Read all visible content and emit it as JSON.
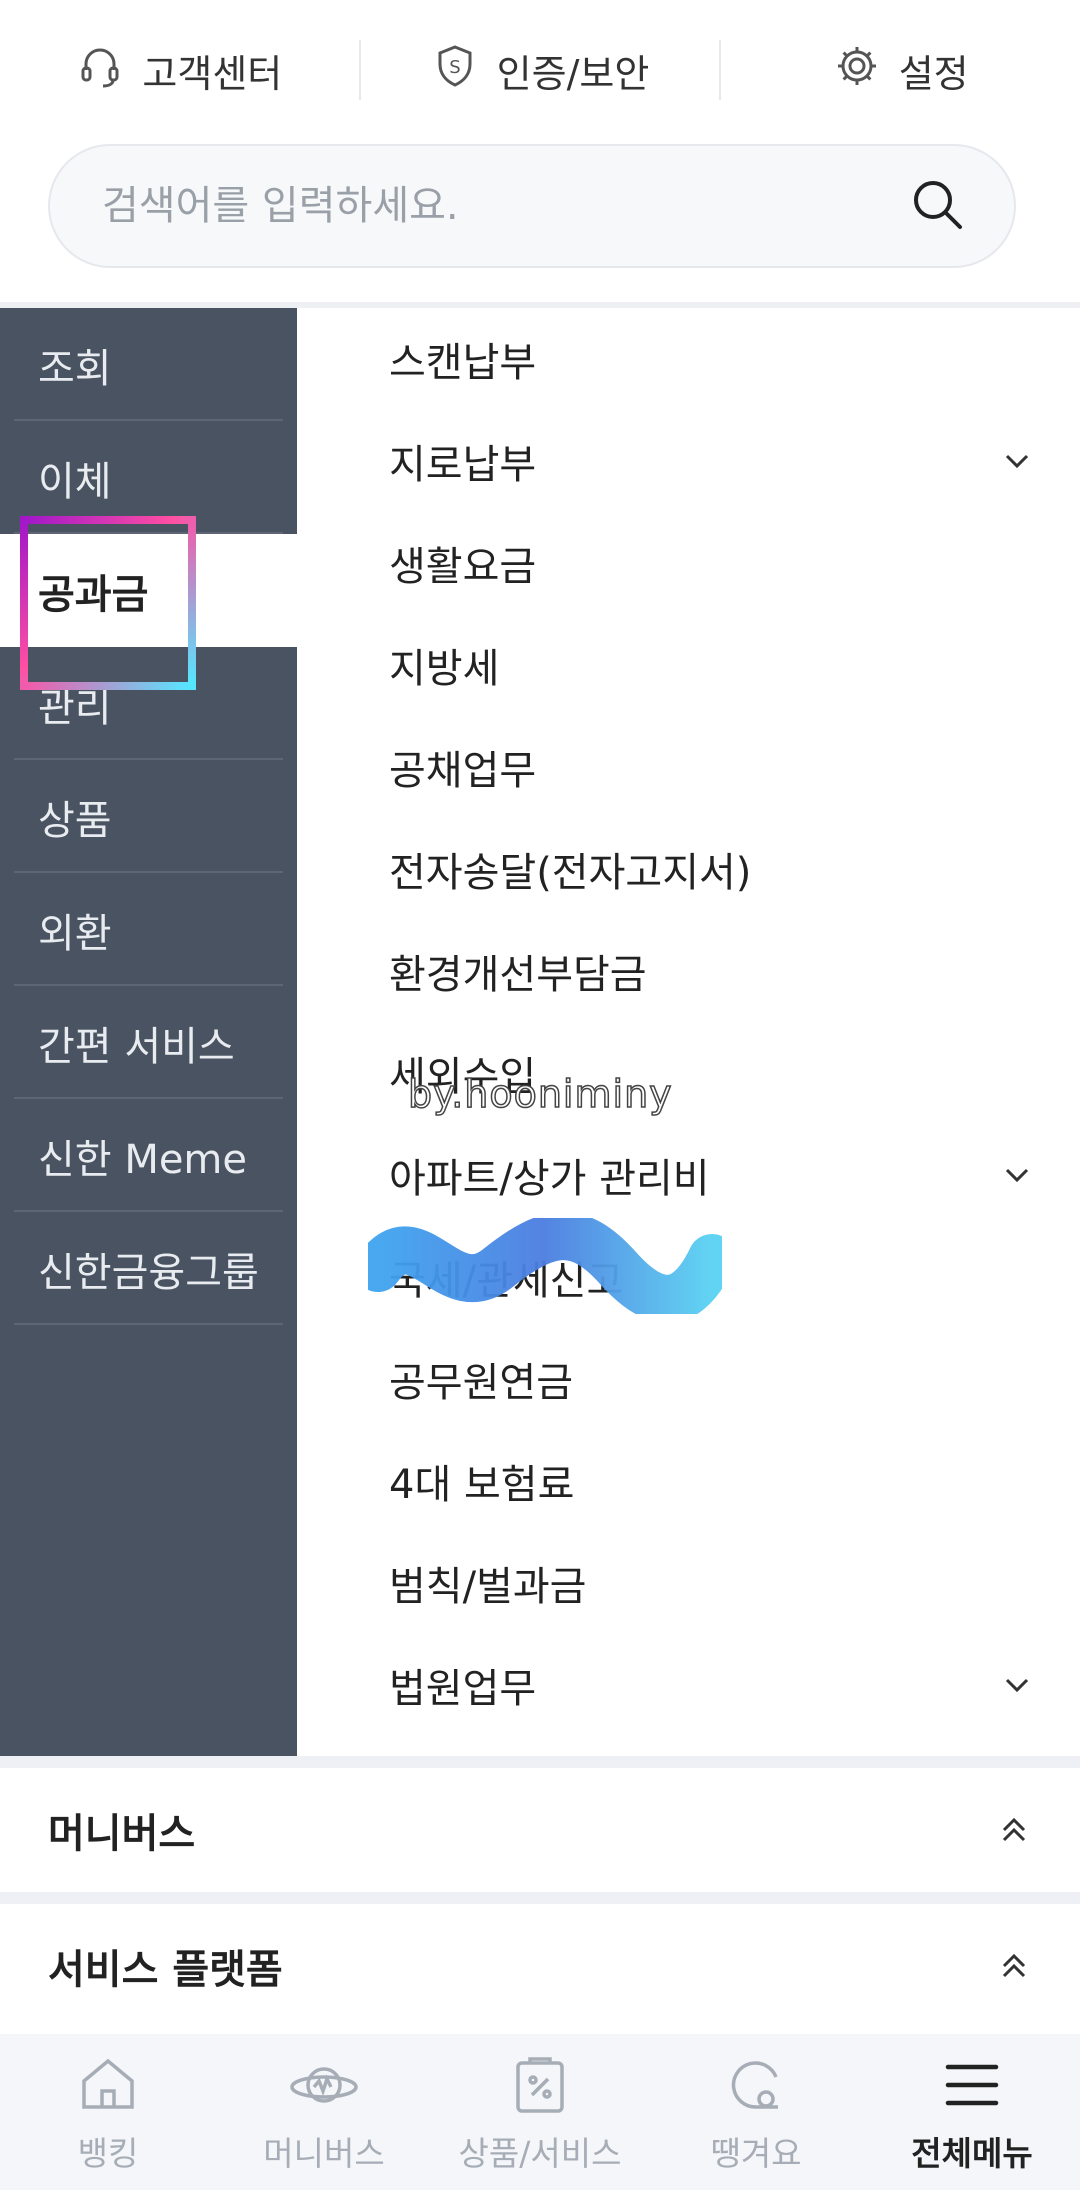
{
  "top_utils": [
    {
      "label": "고객센터",
      "icon": "headset-icon"
    },
    {
      "label": "인증/보안",
      "icon": "shield-icon"
    },
    {
      "label": "설정",
      "icon": "gear-icon"
    }
  ],
  "search": {
    "placeholder": "검색어를 입력하세요."
  },
  "categories": [
    {
      "label": "조회"
    },
    {
      "label": "이체"
    },
    {
      "label": "공과금",
      "active": true
    },
    {
      "label": "관리"
    },
    {
      "label": "상품"
    },
    {
      "label": "외환"
    },
    {
      "label": "간편 서비스"
    },
    {
      "label": "신한 Meme"
    },
    {
      "label": "신한금융그룹"
    }
  ],
  "submenu": [
    {
      "label": "스캔납부"
    },
    {
      "label": "지로납부",
      "expandable": true
    },
    {
      "label": "생활요금"
    },
    {
      "label": "지방세"
    },
    {
      "label": "공채업무"
    },
    {
      "label": "전자송달(전자고지서)"
    },
    {
      "label": "환경개선부담금"
    },
    {
      "label": "세외수입"
    },
    {
      "label": "아파트/상가 관리비",
      "expandable": true
    },
    {
      "label": "국세/관세신고"
    },
    {
      "label": "공무원연금"
    },
    {
      "label": "4대 보험료"
    },
    {
      "label": "범칙/벌과금"
    },
    {
      "label": "법원업무",
      "expandable": true
    }
  ],
  "watermark": "by.hooniminy",
  "sections": [
    {
      "title": "머니버스"
    },
    {
      "title": "서비스 플랫폼"
    }
  ],
  "bottom_nav": [
    {
      "label": "뱅킹",
      "icon": "home-icon"
    },
    {
      "label": "머니버스",
      "icon": "planet-icon"
    },
    {
      "label": "상품/서비스",
      "icon": "product-icon"
    },
    {
      "label": "땡겨요",
      "icon": "delivery-icon"
    },
    {
      "label": "전체메뉴",
      "icon": "hamburger-menu-icon",
      "active": true
    }
  ],
  "colors": {
    "sidebar_bg": "#4a5361",
    "accent_highlight": "#ff4fa3",
    "inactive_nav": "#a7adb6"
  }
}
